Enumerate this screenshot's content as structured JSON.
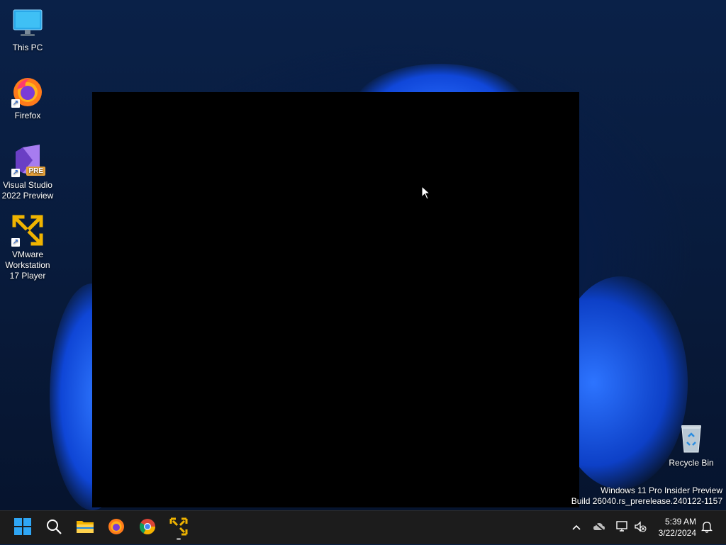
{
  "desktop": {
    "icons": [
      {
        "label": "This PC"
      },
      {
        "label": "Firefox"
      },
      {
        "label_line1": "Visual Studio",
        "label_line2": "2022 Preview",
        "badge": "PRE"
      },
      {
        "label_line1": "VMware",
        "label_line2": "Workstation",
        "label_line3": "17 Player"
      },
      {
        "label": "Recycle Bin"
      }
    ],
    "shortcut_arrow": "↗"
  },
  "watermark": {
    "line1": "Windows 11 Pro Insider Preview",
    "line2": "Build 26040.rs_prerelease.240122-1157"
  },
  "taskbar": {
    "apps": [
      "start-icon",
      "search-icon",
      "file-explorer-icon",
      "firefox-icon",
      "chrome-icon",
      "vmware-icon"
    ],
    "tray_icons": [
      "chevron-up-icon",
      "onedrive-offline-icon",
      "network-icon",
      "volume-muted-icon",
      "notification-bell-icon"
    ],
    "time": "5:39 AM",
    "date": "3/22/2024"
  },
  "colors": {
    "taskbar_bg": "#1c1c1c",
    "vmware_yellow": "#f0b400",
    "vs_purple": "#8b5cd6",
    "pre_badge": "#e8a33a"
  }
}
